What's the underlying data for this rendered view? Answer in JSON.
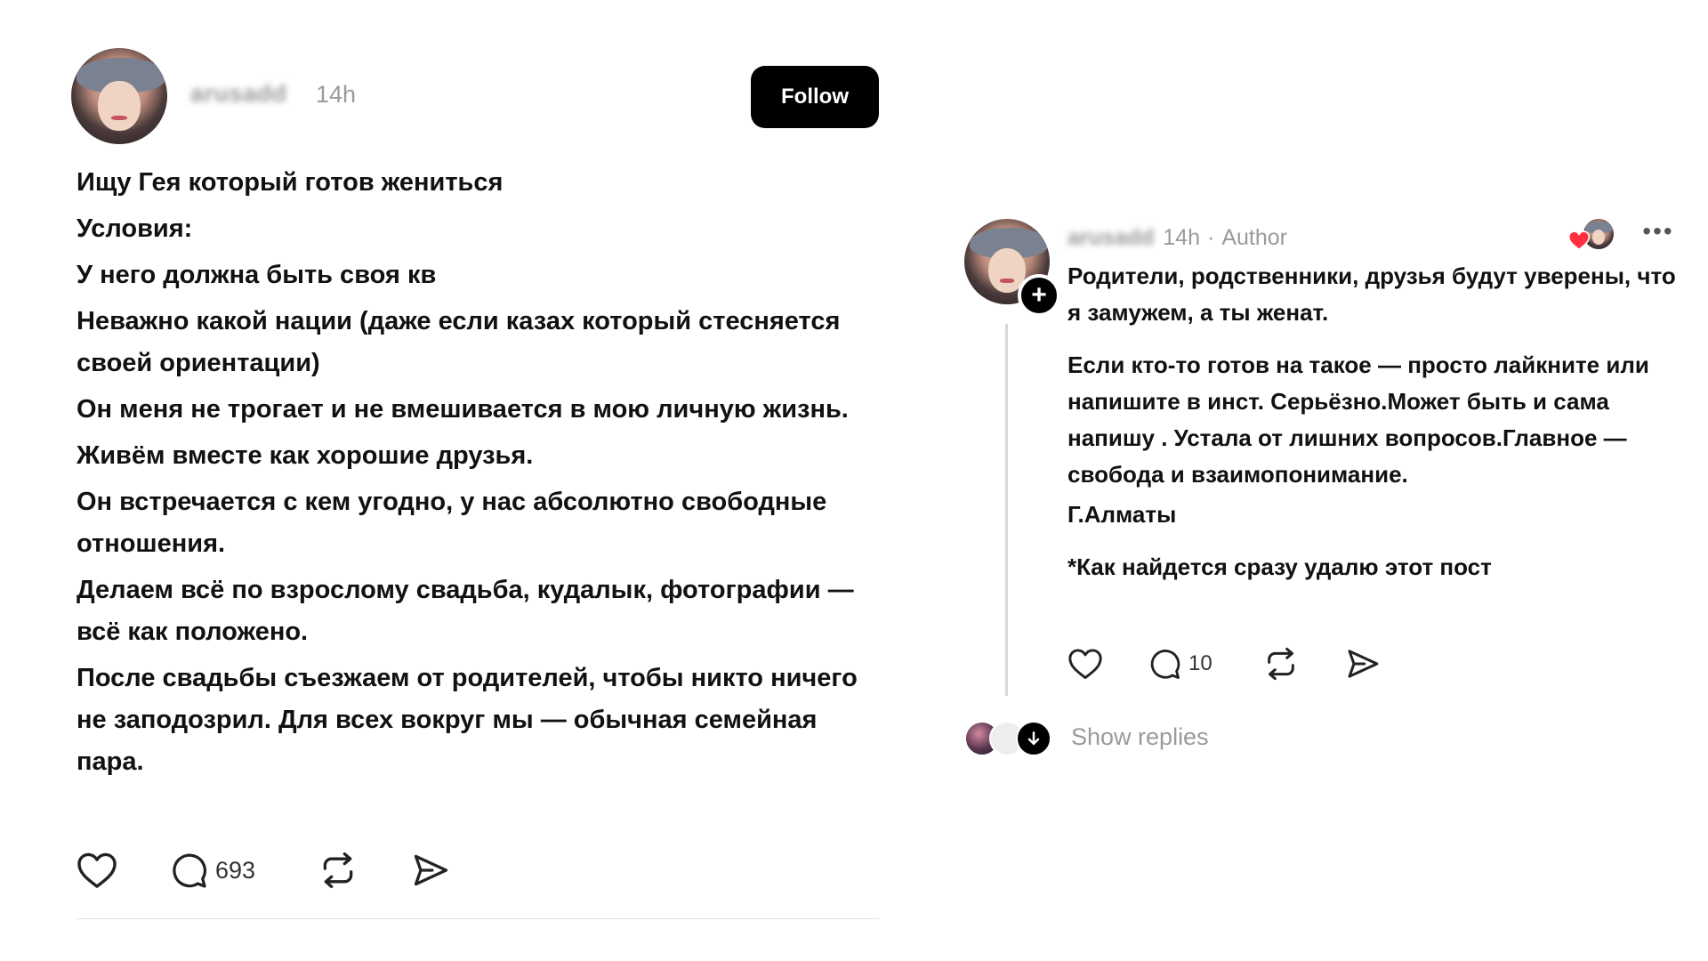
{
  "post": {
    "username": "arusadd",
    "time": "14h",
    "follow_label": "Follow",
    "lines": [
      "Ищу Гея который готов жениться",
      "Условия:",
      "У него должна быть своя кв",
      "Неважно какой нации (даже если казах который стесняется своей ориентации)",
      "Он меня не трогает и не вмешивается в мою личную жизнь.",
      "Живём вместе как хорошие друзья.",
      "Он встречается с кем угодно, у нас абсолютно свободные отношения.",
      "Делаем всё по взрослому свадьба, кудалык, фотографии — всё как положено.",
      "После свадьбы съезжаем от родителей, чтобы никто ничего не заподозрил. Для всех вокруг мы — обычная семейная пара."
    ],
    "comment_count": "693",
    "icons": [
      "heart-icon",
      "comment-icon",
      "repost-icon",
      "share-icon"
    ]
  },
  "reply": {
    "username": "arusadd",
    "time": "14h",
    "dot": "·",
    "author_label": "Author",
    "plus": "+",
    "more": "•••",
    "paragraphs": [
      "Родители, родственники, друзья будут уверены, что я замужем, а ты женат.",
      "Если кто-то готов на такое — просто лайкните или напишите в инст. Серьёзно.Может быть и сама напишу . Устала от лишних вопросов.Главное — свобода и взаимопонимание.",
      "Г.Алматы",
      "*Как найдется сразу удалю этот пост"
    ],
    "comment_count": "10",
    "show_replies": "Show replies",
    "colors": {
      "heart_liked": "#ff3040",
      "muted_text": "#9a9a9a"
    }
  }
}
